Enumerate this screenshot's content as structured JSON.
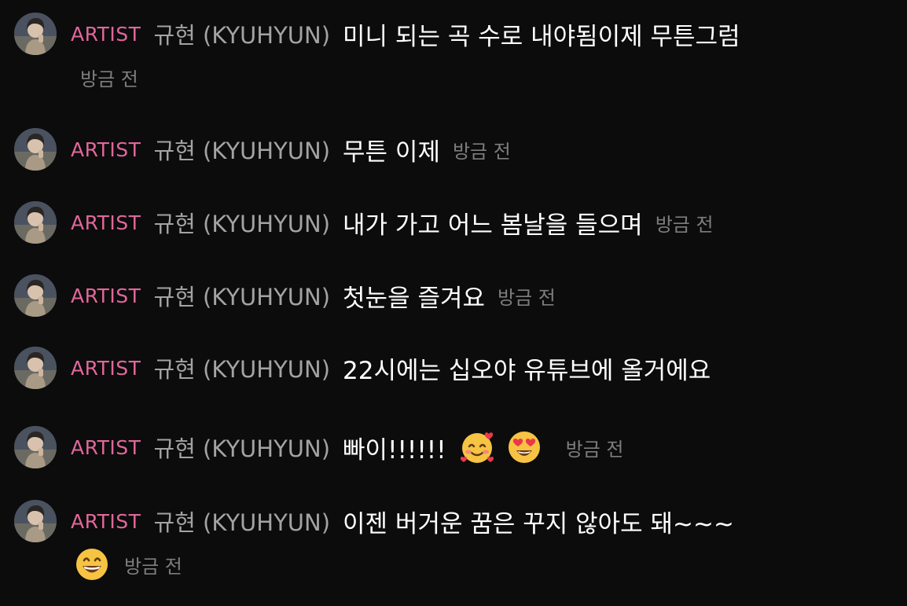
{
  "colors": {
    "background": "#0c0c0c",
    "badge": "#e0679a",
    "name": "#a3a3a3",
    "message": "#ffffff",
    "time": "#7d7d7d"
  },
  "messages": [
    {
      "badge": "ARTIST",
      "name": "규현 (KYUHYUN)",
      "text": "미니 되는 곡 수로 내야됨이제 무튼그럼",
      "time": "방금 전",
      "emojis": []
    },
    {
      "badge": "ARTIST",
      "name": "규현 (KYUHYUN)",
      "text": "무튼 이제",
      "time": "방금 전",
      "emojis": []
    },
    {
      "badge": "ARTIST",
      "name": "규현 (KYUHYUN)",
      "text": "내가 가고 어느 봄날을 들으며",
      "time": "방금 전",
      "emojis": []
    },
    {
      "badge": "ARTIST",
      "name": "규현 (KYUHYUN)",
      "text": "첫눈을 즐겨요",
      "time": "방금 전",
      "emojis": []
    },
    {
      "badge": "ARTIST",
      "name": "규현 (KYUHYUN)",
      "text": "22시에는 십오야 유튜브에 올거에요",
      "time": "",
      "emojis": []
    },
    {
      "badge": "ARTIST",
      "name": "규현 (KYUHYUN)",
      "text": "빠이!!!!!!",
      "time": "방금 전",
      "emojis": [
        "smiling-face-with-hearts-icon",
        "heart-eyes-icon"
      ]
    },
    {
      "badge": "ARTIST",
      "name": "규현 (KYUHYUN)",
      "text": "이젠 버거운 꿈은 꾸지 않아도 돼~~~",
      "time": "방금 전",
      "emojis": [
        "grinning-face-icon"
      ]
    }
  ]
}
